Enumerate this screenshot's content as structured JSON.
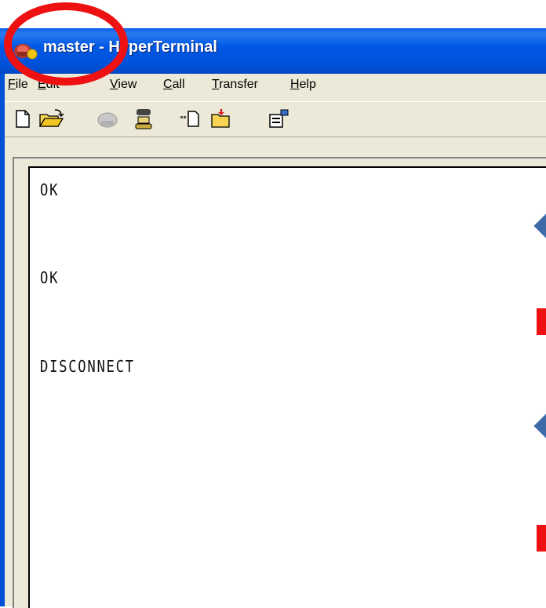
{
  "window": {
    "title": "master - HyperTerminal",
    "icon": "hyperterminal-phone-icon"
  },
  "menu": {
    "items": [
      {
        "label_acc": "F",
        "label_rest": "ile"
      },
      {
        "label_acc": "E",
        "label_rest": "dit"
      },
      {
        "label_acc": "V",
        "label_rest": "iew"
      },
      {
        "label_acc": "C",
        "label_rest": "all"
      },
      {
        "label_acc": "T",
        "label_rest": "ransfer"
      },
      {
        "label_acc": "H",
        "label_rest": "elp"
      }
    ]
  },
  "toolbar": {
    "buttons": [
      "new-connection-icon",
      "open-icon",
      "disconnect-icon",
      "dial-icon",
      "send-icon",
      "receive-icon",
      "properties-icon"
    ]
  },
  "terminal": {
    "lines": [
      "OK",
      "OK",
      "DISCONNECT"
    ]
  },
  "annotations": {
    "circle_color": "#ee1111",
    "diamond_color": "#3e6aa8",
    "bar_color": "#ee1111"
  }
}
